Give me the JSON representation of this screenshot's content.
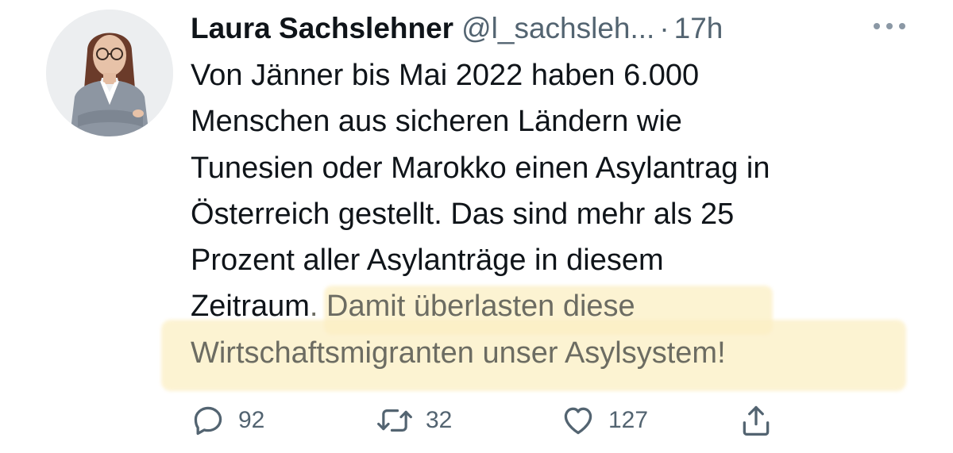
{
  "tweet": {
    "author": {
      "display_name": "Laura Sachslehner",
      "handle": "@l_sachsleh...",
      "time_separator": "·",
      "time": "17h",
      "avatar_icon": "profile-photo"
    },
    "more_icon": "more-horizontal-icon",
    "body": {
      "line1": "Von Jänner bis Mai 2022 haben 6.000",
      "line2": "Menschen aus sicheren Ländern wie",
      "line3": "Tunesien oder Marokko einen Asylantrag in",
      "line4": "Österreich gestellt. Das sind mehr als 25",
      "line5": "Prozent aller Asylanträge in diesem",
      "line6_start": "Zeitraum",
      "line6_end": ". Damit überlasten diese",
      "line7": "Wirtschaftsmigranten unser Asylsystem!"
    },
    "highlight_color": "#fcefc4",
    "actions": {
      "reply": {
        "icon": "reply-icon",
        "count": "92"
      },
      "retweet": {
        "icon": "retweet-icon",
        "count": "32"
      },
      "like": {
        "icon": "heart-icon",
        "count": "127"
      },
      "share": {
        "icon": "share-icon"
      }
    },
    "colors": {
      "text": "#0f1419",
      "secondary": "#536471"
    }
  }
}
